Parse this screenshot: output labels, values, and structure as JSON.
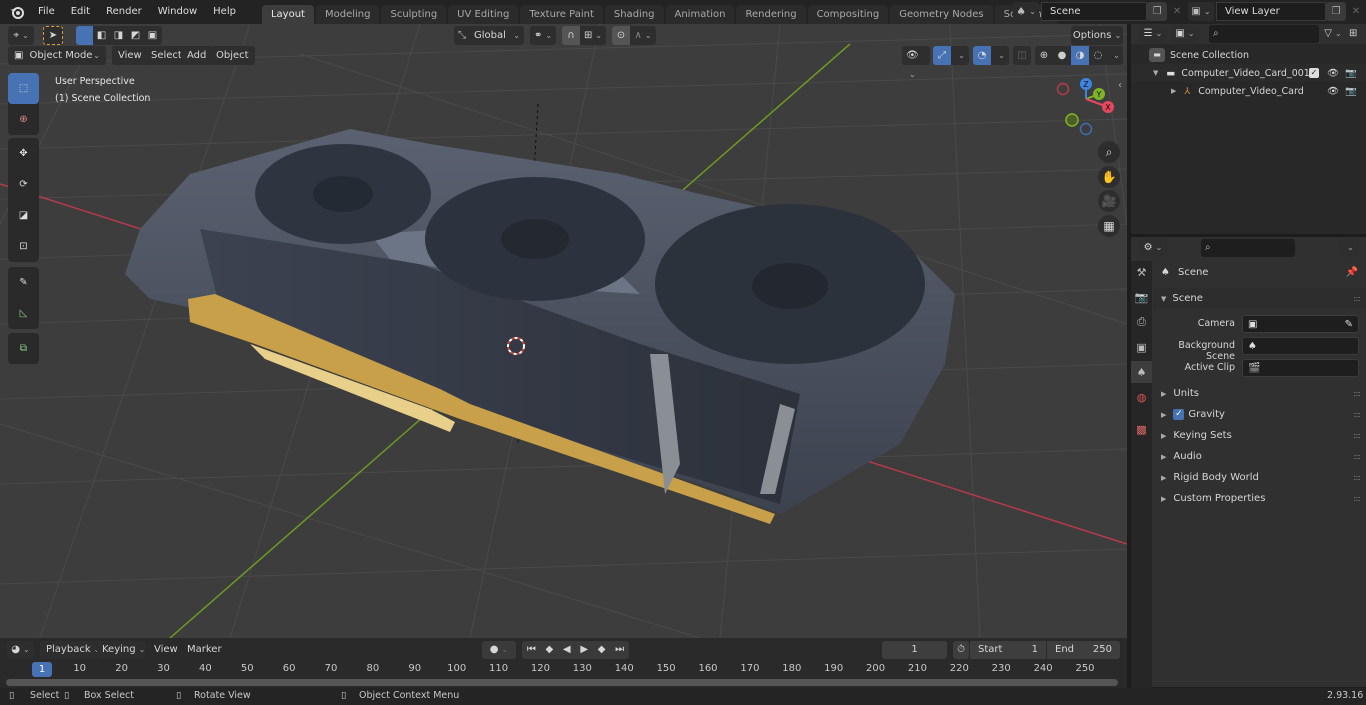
{
  "topbar": {
    "menu": [
      "File",
      "Edit",
      "Render",
      "Window",
      "Help"
    ],
    "workspaces": [
      "Layout",
      "Modeling",
      "Sculpting",
      "UV Editing",
      "Texture Paint",
      "Shading",
      "Animation",
      "Rendering",
      "Compositing",
      "Geometry Nodes",
      "Scripting"
    ],
    "active_workspace": "Layout",
    "scene_name": "Scene",
    "view_layer_name": "View Layer"
  },
  "viewport": {
    "mode": "Object Mode",
    "menus": [
      "View",
      "Select",
      "Add",
      "Object"
    ],
    "transform_orientation": "Global",
    "options_label": "Options",
    "overlay_line1": "User Perspective",
    "overlay_line2": "(1) Scene Collection",
    "gizmo_axes": {
      "x": "X",
      "y": "Y",
      "z": "Z"
    },
    "axis_colors": {
      "x": "#e8485e",
      "y": "#7eb325",
      "z": "#3c85e1"
    },
    "tools": [
      "select-box",
      "cursor",
      "move",
      "rotate",
      "scale",
      "transform",
      "annotate",
      "measure",
      "add-cube"
    ],
    "nav_buttons": [
      "zoom",
      "pan",
      "camera",
      "perspective-ortho"
    ]
  },
  "outliner": {
    "search_placeholder": "",
    "root": "Scene Collection",
    "items": [
      {
        "name": "Computer_Video_Card_001",
        "type": "collection",
        "checked": true,
        "visible": true
      },
      {
        "name": "Computer_Video_Card",
        "type": "empty",
        "visible": true
      }
    ]
  },
  "properties": {
    "header": "Scene",
    "section": "Scene",
    "fields": [
      {
        "label": "Camera",
        "value": ""
      },
      {
        "label": "Background Scene",
        "value": ""
      },
      {
        "label": "Active Clip",
        "value": ""
      }
    ],
    "panels": [
      "Units",
      "Gravity",
      "Keying Sets",
      "Audio",
      "Rigid Body World",
      "Custom Properties"
    ],
    "gravity_enabled": true
  },
  "timeline": {
    "menus": [
      "Playback",
      "Keying",
      "View",
      "Marker"
    ],
    "current_frame": "1",
    "start_label": "Start",
    "start": "1",
    "end_label": "End",
    "end": "250",
    "ticks": [
      "10",
      "20",
      "30",
      "40",
      "50",
      "60",
      "70",
      "80",
      "90",
      "100",
      "110",
      "120",
      "130",
      "140",
      "150",
      "160",
      "170",
      "180",
      "190",
      "200",
      "210",
      "220",
      "230",
      "240",
      "250"
    ],
    "playhead_label": "1"
  },
  "statusbar": {
    "select": "Select",
    "box_select": "Box Select",
    "rotate_view": "Rotate View",
    "context_menu": "Object Context Menu",
    "version": "2.93.16"
  }
}
